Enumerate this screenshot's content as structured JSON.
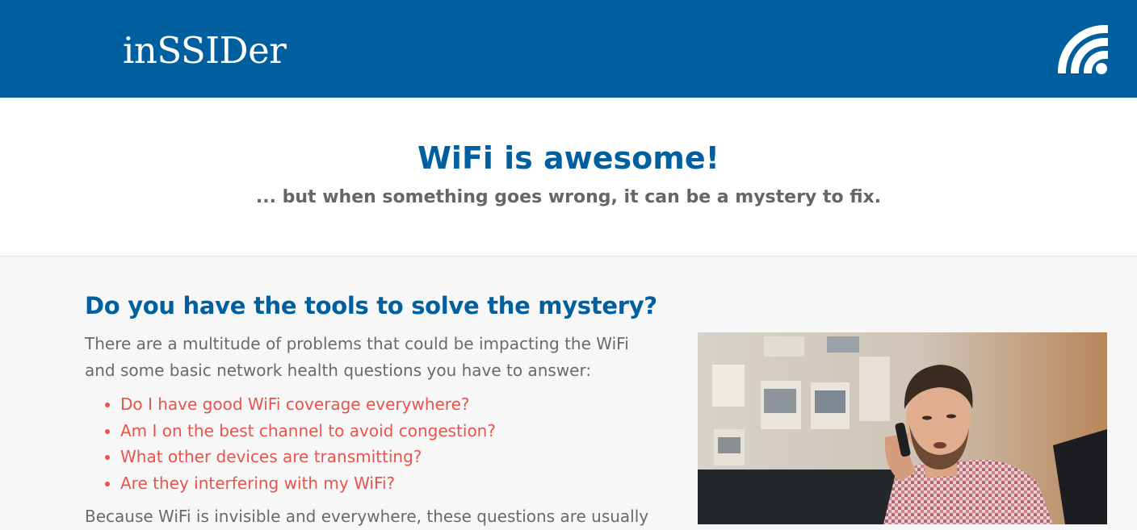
{
  "header": {
    "logo_text": "inSSIDer",
    "logo_icon": "wifi-icon",
    "background_color": "#00609f"
  },
  "hero": {
    "title": "WiFi is awesome!",
    "subtitle": "... but when something goes wrong, it can be a mystery to fix."
  },
  "section": {
    "heading": "Do you have the tools to solve the mystery?",
    "intro": "There are a multitude of problems that could be impacting the WiFi and some basic network health questions you have to answer:",
    "questions": [
      "Do I have good WiFi coverage everywhere?",
      "Am I on the best channel to avoid congestion?",
      "What other devices are transmitting?",
      "Are they interfering with my WiFi?"
    ],
    "outro": "Because WiFi is invisible and everywhere, these questions are usually"
  },
  "colors": {
    "brand_blue": "#00609f",
    "accent_red": "#e8534a",
    "body_gray": "#6a6a6a"
  }
}
